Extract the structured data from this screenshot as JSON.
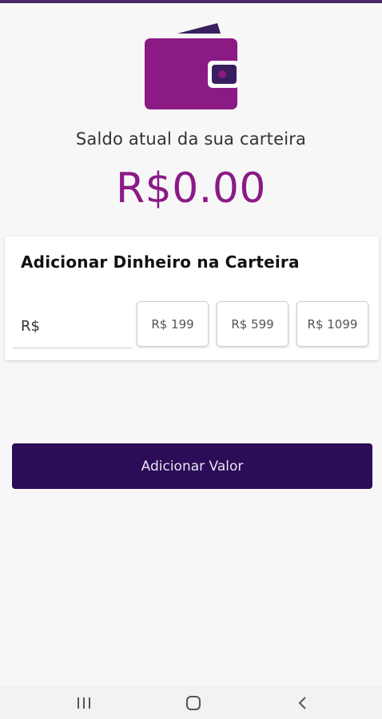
{
  "wallet": {
    "balance_label": "Saldo atual da sua carteira",
    "balance_value": "R$0.00"
  },
  "add_money": {
    "title": "Adicionar Dinheiro na Carteira",
    "input_placeholder": "R$",
    "presets": [
      "R$ 199",
      "R$ 599",
      "R$ 1099"
    ]
  },
  "actions": {
    "submit_label": "Adicionar Valor"
  },
  "colors": {
    "accent": "#8a1a87",
    "primary_dark": "#2c0c57",
    "wallet_purple": "#8b1a85",
    "wallet_clasp": "#3a1f5e"
  },
  "icons": {
    "wallet": "wallet-icon",
    "nav_recents": "recents-icon",
    "nav_home": "home-icon",
    "nav_back": "back-icon"
  }
}
